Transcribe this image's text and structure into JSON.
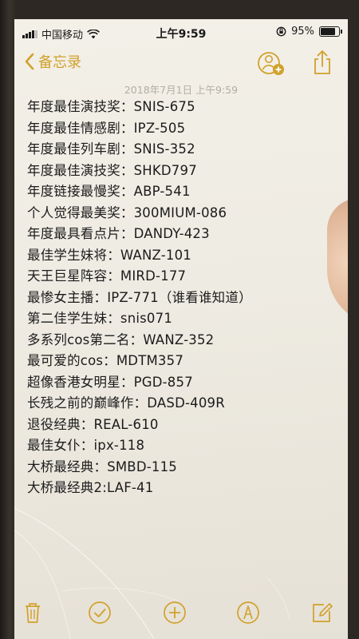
{
  "status_bar": {
    "carrier": "中国移动",
    "time": "上午9:59",
    "battery": "95%",
    "battery_level": 0.95
  },
  "nav": {
    "back_label": "备忘录",
    "icons": [
      "chevron-left-icon",
      "add-collaborator-icon",
      "share-icon"
    ]
  },
  "note": {
    "date": "2018年7月1日 上午9:59",
    "lines": [
      "年度最佳演技奖：SNIS-675",
      "年度最佳情感剧：IPZ-505",
      "年度最佳列车剧：SNIS-352",
      "年度最佳演技奖：SHKD797",
      "年度链接最慢奖：ABP-541",
      "个人觉得最美奖：300MIUM-086",
      "年度最具看点片：DANDY-423",
      "最佳学生妹将：WANZ-101",
      "天王巨星阵容：MIRD-177",
      "最惨女主播：IPZ-771（谁看谁知道）",
      "第二佳学生妹：snis071",
      "多系列cos第二名：WANZ-352",
      "最可爱的cos：MDTM357",
      "超像香港女明星：PGD-857",
      "长残之前的巅峰作：DASD-409R",
      "退役经典：REAL-610",
      "最佳女仆：ipx-118",
      "大桥最经典：SMBD-115",
      "大桥最经典2:LAF-41"
    ]
  },
  "toolbar": {
    "icons": [
      "trash-icon",
      "checklist-icon",
      "add-icon",
      "markup-pen-icon",
      "compose-icon"
    ]
  },
  "colors": {
    "accent": "#d1a12b",
    "paper": "#f1eee6",
    "text": "#1b1b1b",
    "date_text": "#b3ada4"
  }
}
